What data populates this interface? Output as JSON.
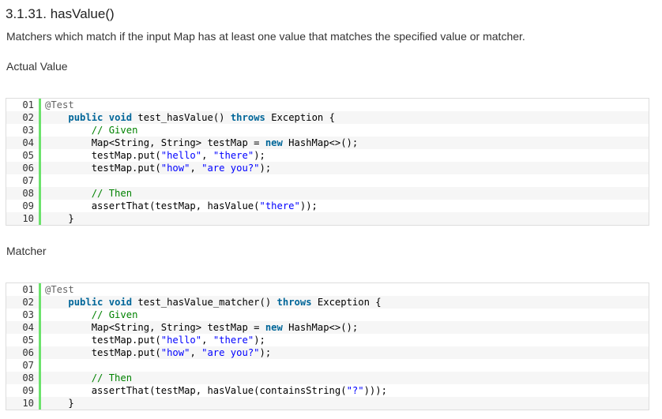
{
  "section": {
    "title": "3.1.31. hasValue()",
    "description": "Matchers which match if the input Map has at least one value that matches the specified value or matcher."
  },
  "examples": [
    {
      "label": "Actual Value",
      "lines": [
        {
          "num": "01",
          "tokens": [
            {
              "t": "ann",
              "v": "@Test"
            }
          ]
        },
        {
          "num": "02",
          "tokens": [
            {
              "t": "pl",
              "v": "    "
            },
            {
              "t": "kw",
              "v": "public"
            },
            {
              "t": "pl",
              "v": " "
            },
            {
              "t": "kw",
              "v": "void"
            },
            {
              "t": "pl",
              "v": " test_hasValue() "
            },
            {
              "t": "kw",
              "v": "throws"
            },
            {
              "t": "pl",
              "v": " Exception {"
            }
          ]
        },
        {
          "num": "03",
          "tokens": [
            {
              "t": "pl",
              "v": "        "
            },
            {
              "t": "cmt",
              "v": "// Given"
            }
          ]
        },
        {
          "num": "04",
          "tokens": [
            {
              "t": "pl",
              "v": "        Map<String, String> testMap = "
            },
            {
              "t": "kw",
              "v": "new"
            },
            {
              "t": "pl",
              "v": " HashMap<>();"
            }
          ]
        },
        {
          "num": "05",
          "tokens": [
            {
              "t": "pl",
              "v": "        testMap.put("
            },
            {
              "t": "str",
              "v": "\"hello\""
            },
            {
              "t": "pl",
              "v": ", "
            },
            {
              "t": "str",
              "v": "\"there\""
            },
            {
              "t": "pl",
              "v": ");"
            }
          ]
        },
        {
          "num": "06",
          "tokens": [
            {
              "t": "pl",
              "v": "        testMap.put("
            },
            {
              "t": "str",
              "v": "\"how\""
            },
            {
              "t": "pl",
              "v": ", "
            },
            {
              "t": "str",
              "v": "\"are you?\""
            },
            {
              "t": "pl",
              "v": ");"
            }
          ]
        },
        {
          "num": "07",
          "tokens": []
        },
        {
          "num": "08",
          "tokens": [
            {
              "t": "pl",
              "v": "        "
            },
            {
              "t": "cmt",
              "v": "// Then"
            }
          ]
        },
        {
          "num": "09",
          "tokens": [
            {
              "t": "pl",
              "v": "        assertThat(testMap, hasValue("
            },
            {
              "t": "str",
              "v": "\"there\""
            },
            {
              "t": "pl",
              "v": "));"
            }
          ]
        },
        {
          "num": "10",
          "tokens": [
            {
              "t": "pl",
              "v": "    }"
            }
          ]
        }
      ]
    },
    {
      "label": "Matcher",
      "lines": [
        {
          "num": "01",
          "tokens": [
            {
              "t": "ann",
              "v": "@Test"
            }
          ]
        },
        {
          "num": "02",
          "tokens": [
            {
              "t": "pl",
              "v": "    "
            },
            {
              "t": "kw",
              "v": "public"
            },
            {
              "t": "pl",
              "v": " "
            },
            {
              "t": "kw",
              "v": "void"
            },
            {
              "t": "pl",
              "v": " test_hasValue_matcher() "
            },
            {
              "t": "kw",
              "v": "throws"
            },
            {
              "t": "pl",
              "v": " Exception {"
            }
          ]
        },
        {
          "num": "03",
          "tokens": [
            {
              "t": "pl",
              "v": "        "
            },
            {
              "t": "cmt",
              "v": "// Given"
            }
          ]
        },
        {
          "num": "04",
          "tokens": [
            {
              "t": "pl",
              "v": "        Map<String, String> testMap = "
            },
            {
              "t": "kw",
              "v": "new"
            },
            {
              "t": "pl",
              "v": " HashMap<>();"
            }
          ]
        },
        {
          "num": "05",
          "tokens": [
            {
              "t": "pl",
              "v": "        testMap.put("
            },
            {
              "t": "str",
              "v": "\"hello\""
            },
            {
              "t": "pl",
              "v": ", "
            },
            {
              "t": "str",
              "v": "\"there\""
            },
            {
              "t": "pl",
              "v": ");"
            }
          ]
        },
        {
          "num": "06",
          "tokens": [
            {
              "t": "pl",
              "v": "        testMap.put("
            },
            {
              "t": "str",
              "v": "\"how\""
            },
            {
              "t": "pl",
              "v": ", "
            },
            {
              "t": "str",
              "v": "\"are you?\""
            },
            {
              "t": "pl",
              "v": ");"
            }
          ]
        },
        {
          "num": "07",
          "tokens": []
        },
        {
          "num": "08",
          "tokens": [
            {
              "t": "pl",
              "v": "        "
            },
            {
              "t": "cmt",
              "v": "// Then"
            }
          ]
        },
        {
          "num": "09",
          "tokens": [
            {
              "t": "pl",
              "v": "        assertThat(testMap, hasValue(containsString("
            },
            {
              "t": "str",
              "v": "\"?\""
            },
            {
              "t": "pl",
              "v": ")));"
            }
          ]
        },
        {
          "num": "10",
          "tokens": [
            {
              "t": "pl",
              "v": "    }"
            }
          ]
        }
      ]
    }
  ]
}
